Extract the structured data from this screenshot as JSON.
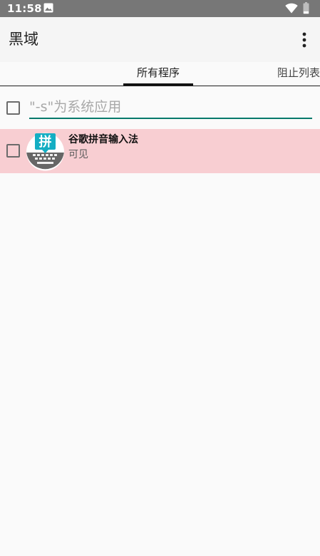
{
  "status_bar": {
    "time": "11:58",
    "icons": [
      "gallery-icon",
      "wifi-icon",
      "battery-icon"
    ],
    "background": "#777777"
  },
  "app_bar": {
    "title": "黑域",
    "menu_icon": "overflow-menu-icon"
  },
  "tabs": [
    {
      "label": "所有程序",
      "selected": true
    },
    {
      "label": "阻止列表",
      "selected": false
    }
  ],
  "filter": {
    "checked": false,
    "placeholder": "\"-s\"为系统应用",
    "value": "",
    "accent": "#00796b"
  },
  "apps": [
    {
      "name": "谷歌拼音输入法",
      "status": "可见",
      "checked": false,
      "icon": "google-pinyin-keyboard-icon",
      "icon_glyph": "拼",
      "row_color": "#f8ced2"
    }
  ]
}
